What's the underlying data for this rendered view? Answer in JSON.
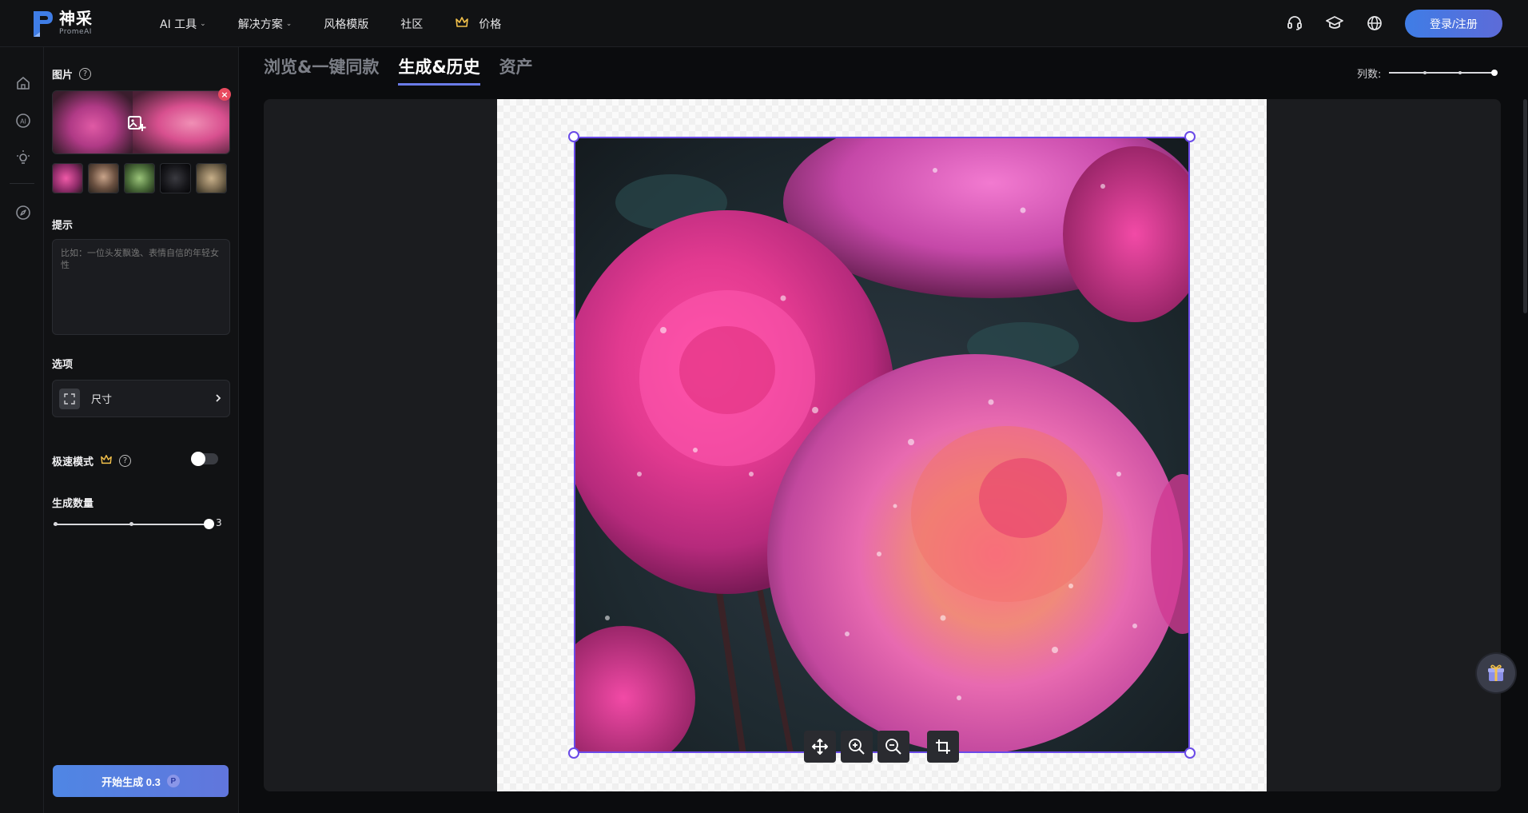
{
  "app": {
    "logo_cn": "神采",
    "logo_en": "PromeAI"
  },
  "nav": {
    "ai_tools": "AI 工具",
    "solutions": "解决方案",
    "style_templates": "风格模版",
    "community": "社区",
    "pricing": "价格",
    "login": "登录/注册"
  },
  "panel": {
    "image_title": "图片",
    "prompt_title": "提示",
    "prompt_placeholder": "比如：一位头发飘逸、表情自信的年轻女性",
    "options_title": "选项",
    "size_label": "尺寸",
    "turbo_label": "极速模式",
    "count_label": "生成数量",
    "count_value": "3",
    "count_fraction": 1.0,
    "generate_label": "开始生成 0.3"
  },
  "tabs": [
    {
      "label": "浏览&一键同款",
      "active": false
    },
    {
      "label": "生成&历史",
      "active": true
    },
    {
      "label": "资产",
      "active": false
    }
  ],
  "columns": {
    "label": "列数:",
    "fraction": 1.0
  },
  "colors": {
    "accent": "#6a7be8",
    "selection": "#6a4ae8",
    "brand_button": "#4f86e4",
    "close_badge": "#e84a5f",
    "crown": "#f3c14b"
  },
  "icons": {
    "support": "headset-icon",
    "learn": "graduation-cap-icon",
    "language": "globe-icon",
    "move": "move-icon",
    "zoom_in": "zoom-in-icon",
    "zoom_out": "zoom-out-icon",
    "crop": "crop-icon",
    "gift": "gift-icon"
  }
}
